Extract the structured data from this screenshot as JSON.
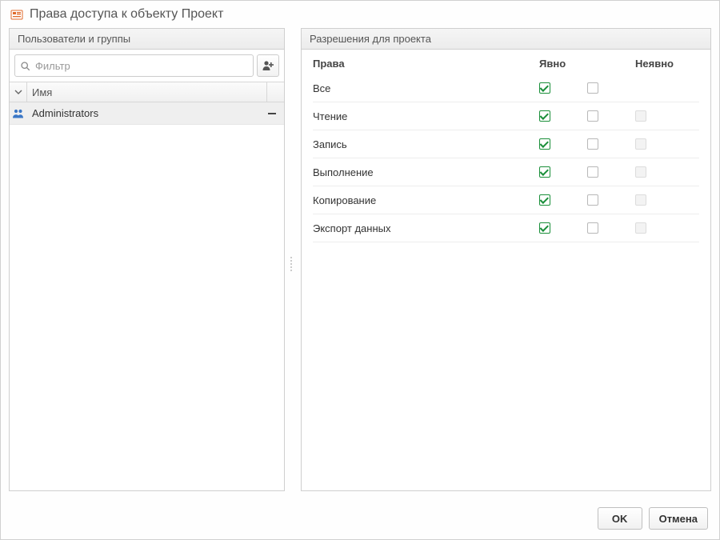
{
  "dialog": {
    "title": "Права доступа к объекту Проект"
  },
  "left": {
    "header": "Пользователи и группы",
    "filter_placeholder": "Фильтр",
    "name_column": "Имя",
    "items": [
      {
        "label": "Administrators",
        "kind": "group",
        "selected": true
      }
    ]
  },
  "right": {
    "header": "Разрешения для проекта",
    "columns": {
      "name": "Права",
      "explicit": "Явно",
      "implicit": "Неявно"
    },
    "rows": [
      {
        "name": "Все",
        "exp_allow": true,
        "exp_deny": false,
        "implicit_present": false,
        "implicit_checked": false
      },
      {
        "name": "Чтение",
        "exp_allow": true,
        "exp_deny": false,
        "implicit_present": true,
        "implicit_checked": false
      },
      {
        "name": "Запись",
        "exp_allow": true,
        "exp_deny": false,
        "implicit_present": true,
        "implicit_checked": false
      },
      {
        "name": "Выполнение",
        "exp_allow": true,
        "exp_deny": false,
        "implicit_present": true,
        "implicit_checked": false
      },
      {
        "name": "Копирование",
        "exp_allow": true,
        "exp_deny": false,
        "implicit_present": true,
        "implicit_checked": false
      },
      {
        "name": "Экспорт данных",
        "exp_allow": true,
        "exp_deny": false,
        "implicit_present": true,
        "implicit_checked": false
      }
    ]
  },
  "footer": {
    "ok": "OK",
    "cancel": "Отмена"
  }
}
